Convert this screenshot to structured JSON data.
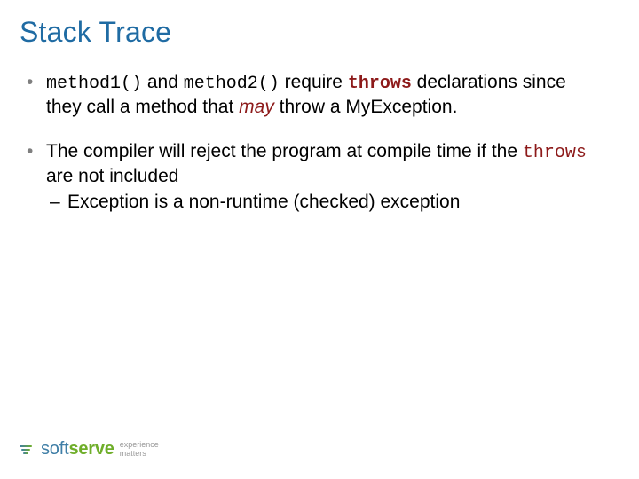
{
  "title": "Stack Trace",
  "bullets": [
    {
      "segments": [
        {
          "text": "method1()",
          "cls": "mono"
        },
        {
          "text": " and ",
          "cls": ""
        },
        {
          "text": "method2()",
          "cls": "mono"
        },
        {
          "text": " require ",
          "cls": ""
        },
        {
          "text": "throws",
          "cls": "kw"
        },
        {
          "text": " declarations since they call a method that ",
          "cls": ""
        },
        {
          "text": "may",
          "cls": "em"
        },
        {
          "text": " throw a MyException.",
          "cls": ""
        }
      ],
      "sub": []
    },
    {
      "segments": [
        {
          "text": "The compiler will reject the program at compile time if the ",
          "cls": ""
        },
        {
          "text": "throws",
          "cls": "kw-plain"
        },
        {
          "text": " are not included",
          "cls": ""
        }
      ],
      "sub": [
        {
          "segments": [
            {
              "text": "Exception is a non-runtime (checked) exception",
              "cls": ""
            }
          ]
        }
      ]
    }
  ],
  "brand": {
    "part1": "soft",
    "part2": "serve",
    "tag1": "experience",
    "tag2": "matters"
  }
}
